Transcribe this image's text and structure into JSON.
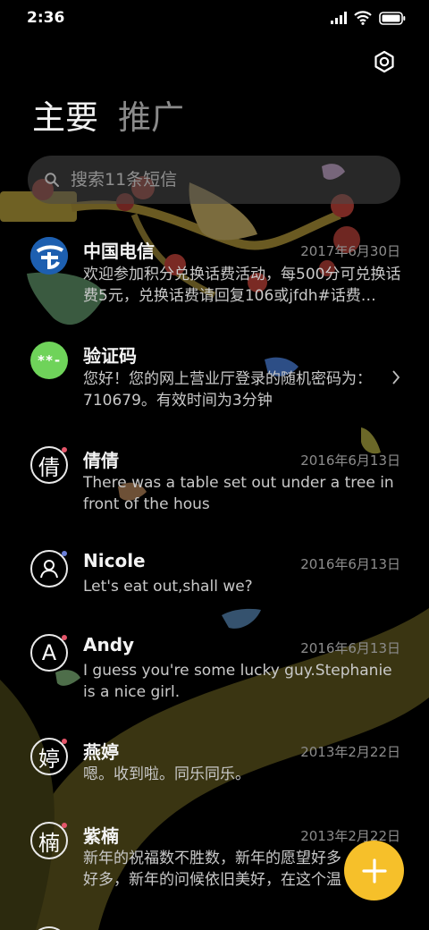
{
  "status": {
    "time": "2:36"
  },
  "tabs": {
    "primary": "主要",
    "promo": "推广"
  },
  "search": {
    "placeholder": "搜索11条短信"
  },
  "messages": [
    {
      "name": "中国电信",
      "date": "2017年6月30日",
      "preview": "欢迎参加积分兑换话费活动，每500分可兑换话费5元，兑换话费请回复106或jfdh#话费…"
    },
    {
      "name": "验证码",
      "date": "",
      "preview": "您好！您的网上营业厅登录的随机密码为：710679。有效时间为3分钟",
      "avatar_text": "**-"
    },
    {
      "name": "倩倩",
      "date": "2016年6月13日",
      "preview": "There was a table set out under a tree in front of the hous",
      "avatar_text": "倩"
    },
    {
      "name": "Nicole",
      "date": "2016年6月13日",
      "preview": "Let's eat out,shall we?"
    },
    {
      "name": "Andy",
      "date": "2016年6月13日",
      "preview": "I guess you're some lucky guy.Stephanie is a nice girl.",
      "avatar_text": "A"
    },
    {
      "name": "燕婷",
      "date": "2013年2月22日",
      "preview": "嗯。收到啦。同乐同乐。",
      "avatar_text": "婷"
    },
    {
      "name": "紫楠",
      "date": "2013年2月22日",
      "preview": "新年的祝福数不胜数，新年的愿望好多好多，新年的问候依旧美好，在这个温馨的时刻…",
      "avatar_text": "楠"
    }
  ],
  "icons": {
    "settings": "gear-icon",
    "search": "search-icon",
    "compose": "plus-icon",
    "chevron": "chevron-right-icon"
  },
  "colors": {
    "accent": "#f6c02a",
    "verify_avatar": "#6fd35a",
    "telecom_avatar": "#1d5fb0"
  }
}
